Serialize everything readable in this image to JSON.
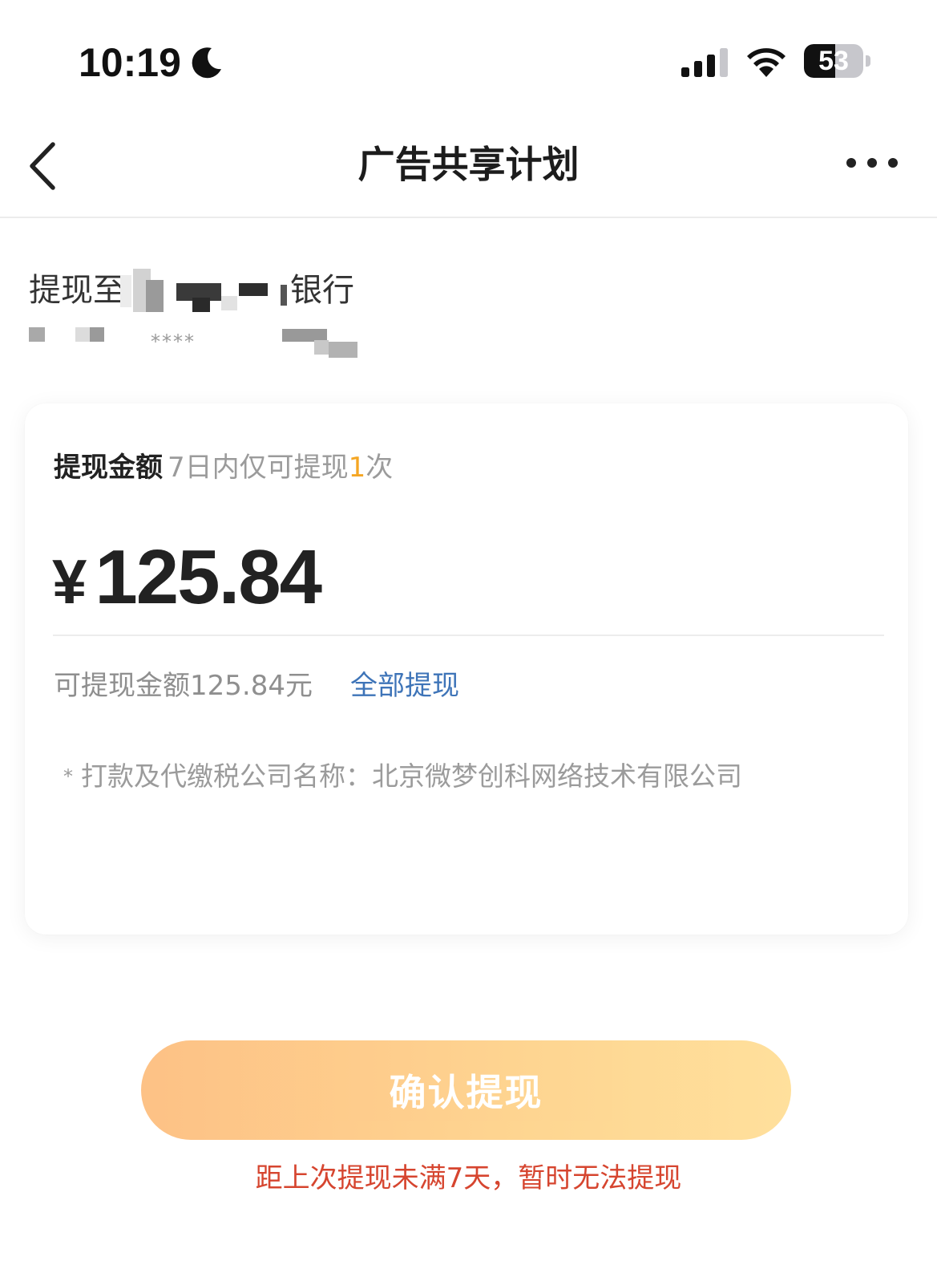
{
  "status_bar": {
    "time": "10:19",
    "battery_level": "53",
    "battery_fraction": 0.53,
    "icons": [
      "moon-icon",
      "signal-icon",
      "wifi-icon",
      "battery-icon"
    ]
  },
  "nav": {
    "title": "广告共享计划",
    "back_icon": "chevron-left-icon",
    "more_icon": "more-dots-icon"
  },
  "withdraw_target": {
    "label_prefix": "提现至",
    "bank_suffix": "银行",
    "account_mask": "****"
  },
  "card": {
    "amount_label": "提现金额",
    "limit_text_before": "7日内仅可提现",
    "limit_count": "1",
    "limit_text_after": "次",
    "currency": "¥",
    "amount": "125.84",
    "available_text": "可提现金额125.84元",
    "withdraw_all": "全部提现",
    "note_star": "*",
    "company_note": "打款及代缴税公司名称：北京微梦创科网络技术有限公司"
  },
  "confirm": {
    "label": "确认提现",
    "error_tip": "距上次提现未满7天，暂时无法提现"
  },
  "colors": {
    "accent_orange": "#f5a623",
    "link_blue": "#3e74b8",
    "error_red": "#d6452f",
    "button_gradient_start": "#fdc083",
    "button_gradient_end": "#ffdf9a"
  }
}
